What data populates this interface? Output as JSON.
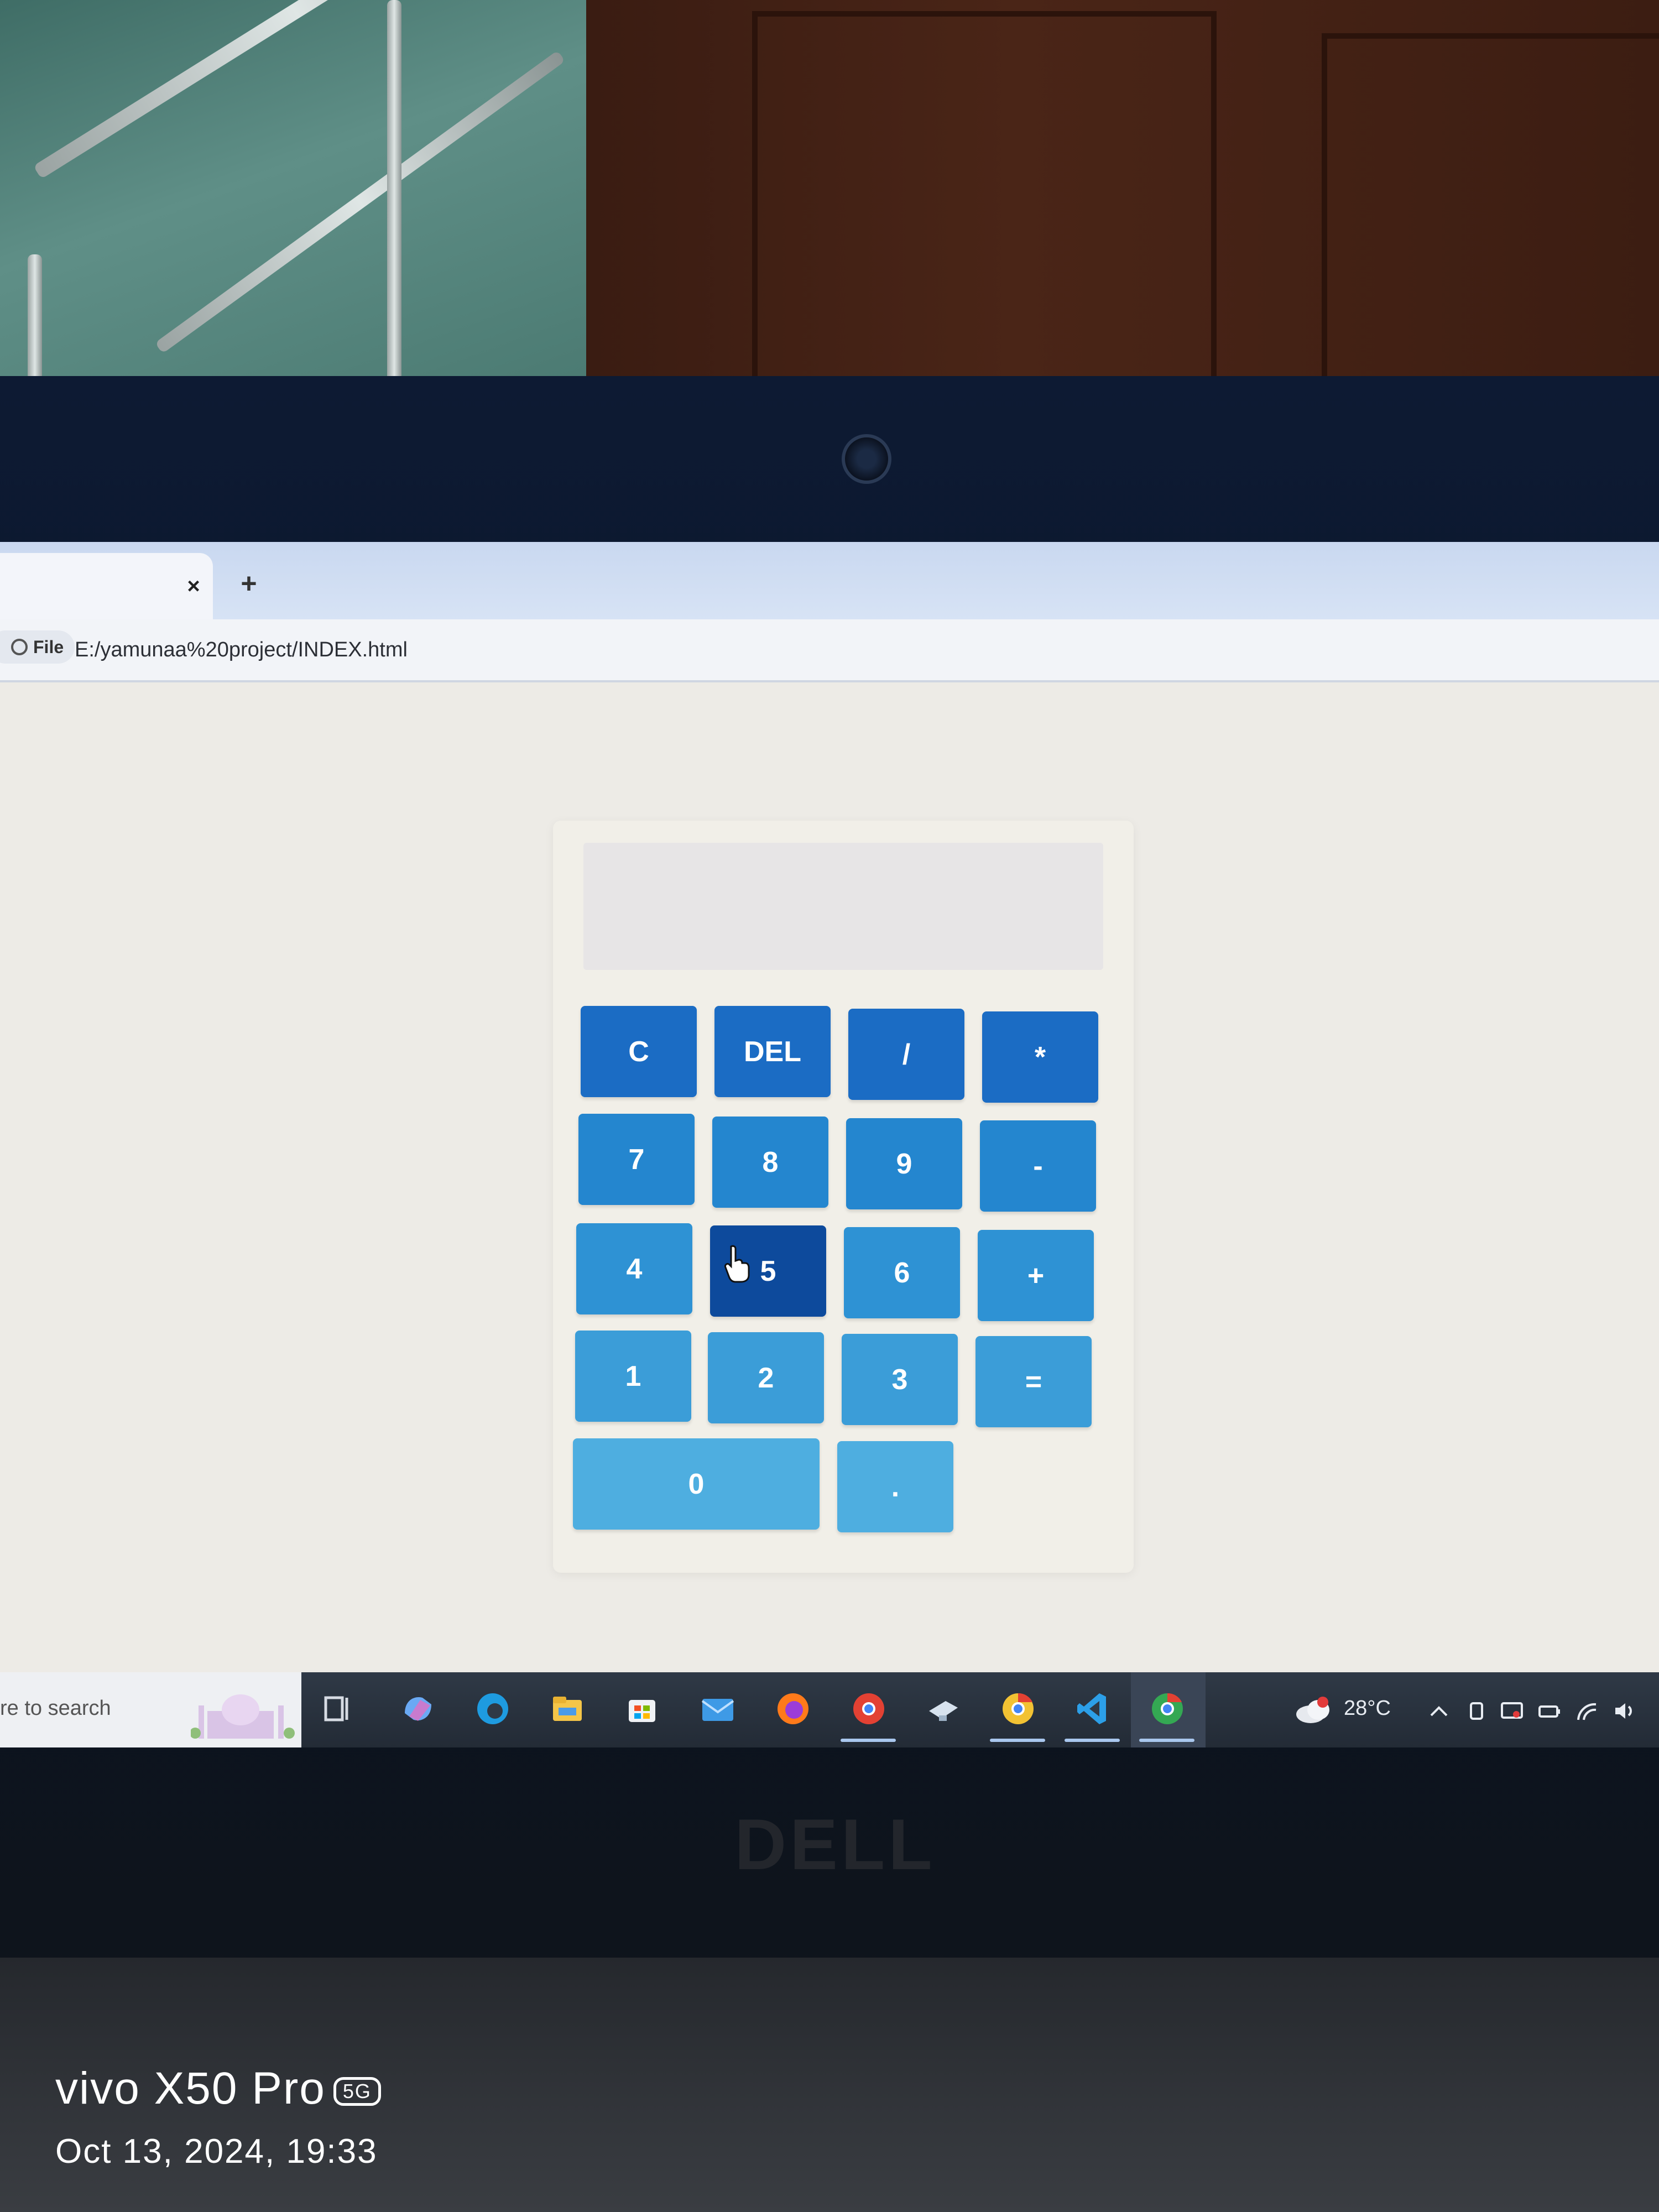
{
  "browser": {
    "tab_close": "×",
    "tab_new": "+",
    "file_chip": "File",
    "url": "E:/yamunaa%20project/INDEX.html"
  },
  "calculator": {
    "display": "",
    "buttons": {
      "clear": "C",
      "delete": "DEL",
      "divide": "/",
      "multiply": "*",
      "seven": "7",
      "eight": "8",
      "nine": "9",
      "subtract": "-",
      "four": "4",
      "five": "5",
      "six": "6",
      "add": "+",
      "one": "1",
      "two": "2",
      "three": "3",
      "equals": "=",
      "zero": "0",
      "decimal": "."
    },
    "colors": {
      "row1": "#1b6cc4",
      "row5": "#4eaee0",
      "pressed": "#0d4a9c"
    }
  },
  "taskbar": {
    "search_text": "re to search",
    "temperature": "28°C"
  },
  "device": {
    "laptop_brand": "DELL"
  },
  "camera_watermark": {
    "model": "vivo X50 Pro",
    "network": "5G",
    "timestamp": "Oct 13, 2024, 19:33"
  }
}
